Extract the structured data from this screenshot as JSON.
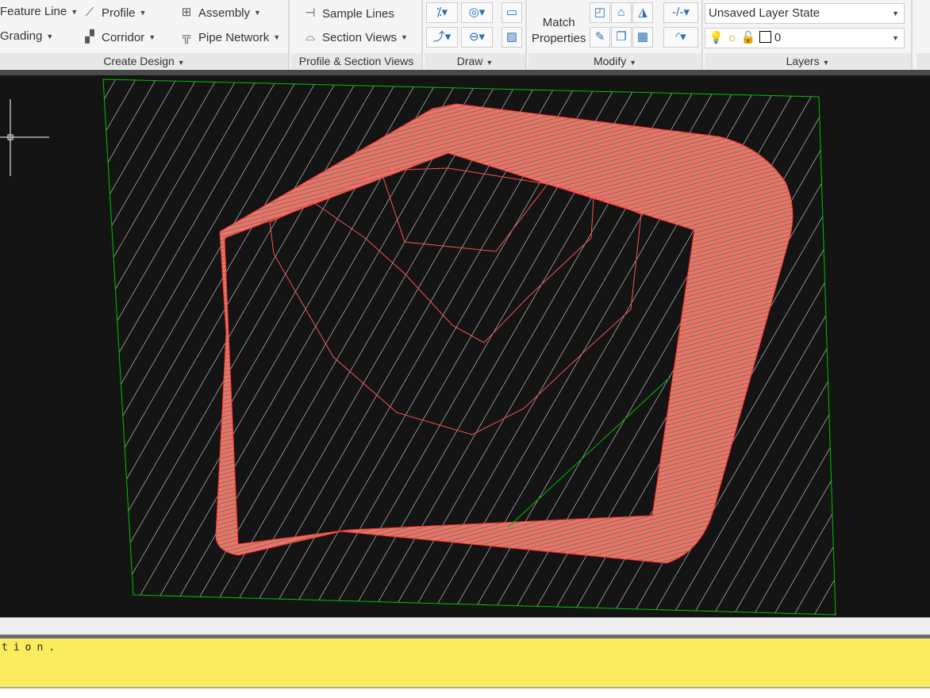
{
  "ribbon": {
    "create_design": {
      "title": "Create Design",
      "items": [
        {
          "label": "Feature Line"
        },
        {
          "label": "Grading"
        },
        {
          "label": "Profile"
        },
        {
          "label": "Corridor"
        },
        {
          "label": "Assembly"
        },
        {
          "label": "Pipe Network"
        }
      ]
    },
    "profile_section": {
      "title": "Profile & Section Views",
      "items": [
        {
          "label": "Sample Lines"
        },
        {
          "label": "Section Views"
        }
      ]
    },
    "draw": {
      "title": "Draw"
    },
    "modify": {
      "title": "Modify",
      "match_properties": "Match\nProperties",
      "match_line1": "Match",
      "match_line2": "Properties"
    },
    "layers": {
      "title": "Layers",
      "layer_state": "Unsaved Layer State",
      "current_layer": "0"
    }
  },
  "command_line": {
    "text": "tion."
  },
  "colors": {
    "canvas": "#141414",
    "corridor": "#f07070",
    "boundary": "#00c000",
    "hatch": "#ffffff",
    "command_bg": "#fbec5d"
  }
}
